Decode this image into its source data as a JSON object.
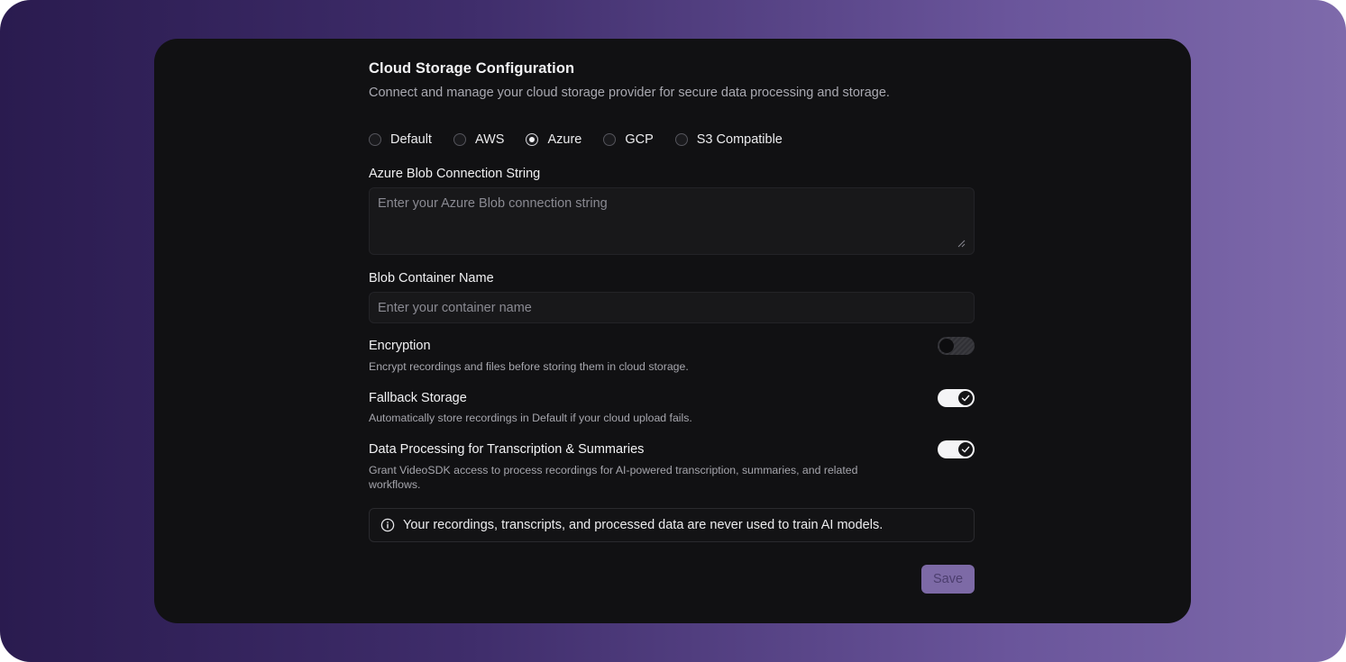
{
  "title": "Cloud Storage Configuration",
  "subtitle": "Connect and manage your cloud storage provider for secure data processing and storage.",
  "providers": [
    {
      "label": "Default",
      "selected": false
    },
    {
      "label": "AWS",
      "selected": false
    },
    {
      "label": "Azure",
      "selected": true
    },
    {
      "label": "GCP",
      "selected": false
    },
    {
      "label": "S3 Compatible",
      "selected": false
    }
  ],
  "connection_string": {
    "label": "Azure Blob Connection String",
    "placeholder": "Enter your Azure Blob connection string",
    "value": ""
  },
  "container_name": {
    "label": "Blob Container Name",
    "placeholder": "Enter your container name",
    "value": ""
  },
  "settings": {
    "encryption": {
      "title": "Encryption",
      "description": "Encrypt recordings and files before storing them in cloud storage.",
      "enabled": false
    },
    "fallback": {
      "title": "Fallback Storage",
      "description": "Automatically store recordings in Default if your cloud upload fails.",
      "enabled": true
    },
    "processing": {
      "title": "Data Processing for Transcription & Summaries",
      "description": "Grant VideoSDK access to process recordings for AI-powered transcription, summaries, and related workflows.",
      "enabled": true
    }
  },
  "notice": {
    "icon": "info-icon",
    "text": "Your recordings, transcripts, and processed data are never used to train AI models."
  },
  "save_label": "Save",
  "colors": {
    "accent": "#7d6aa6",
    "panel_bg": "#111113",
    "background_gradient_start": "#2a1b4f",
    "background_gradient_end": "#7e6aab"
  }
}
